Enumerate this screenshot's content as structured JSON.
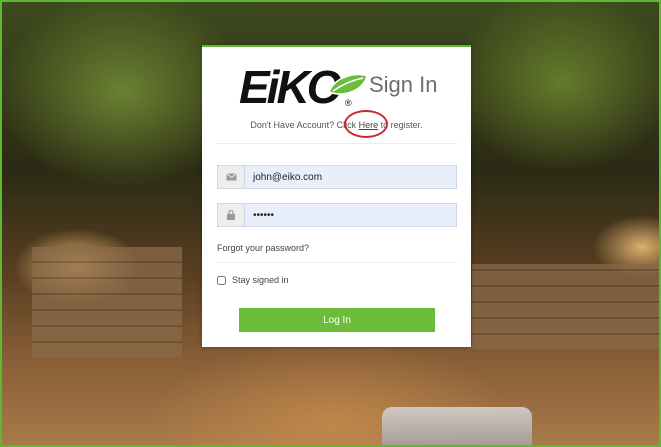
{
  "brand": {
    "logo_text": "EiKO",
    "registered_mark": "®",
    "accent_color": "#6cbd3c",
    "frame_color": "#5fb832"
  },
  "login_card": {
    "title": "Sign In",
    "register_prefix": "Don't Have Account? Click ",
    "register_link": "Here",
    "register_suffix": " to register.",
    "email": {
      "value": "john@eiko.com",
      "icon": "envelope-icon"
    },
    "password": {
      "value": "••••••",
      "icon": "lock-icon"
    },
    "forgot_link": "Forgot your password?",
    "stay_signed_in_label": "Stay signed in",
    "stay_signed_in_checked": false,
    "login_button": "Log In"
  },
  "annotation": {
    "highlight_color": "#c8272d"
  }
}
